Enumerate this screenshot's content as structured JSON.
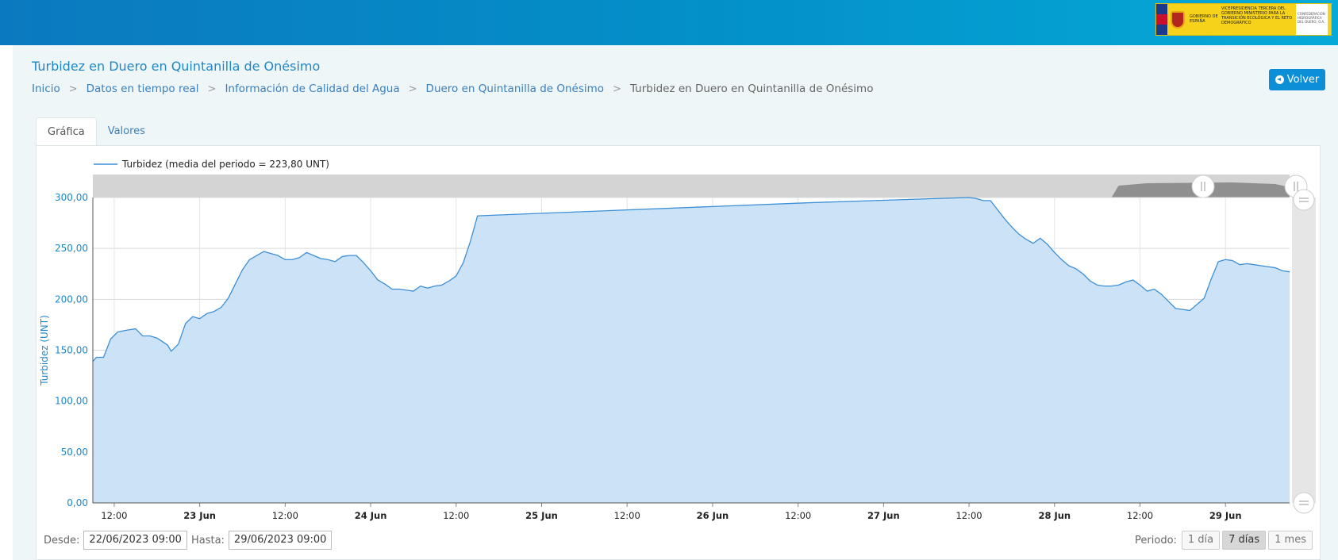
{
  "header": {
    "logo": {
      "gov_line": "GOBIERNO DE ESPAÑA",
      "ministry_line": "VICEPRESIDENCIA TERCERA DEL GOBIERNO MINISTERIO PARA LA TRANSICIÓN ECOLÓGICA Y EL RETO DEMOGRÁFICO",
      "agency_line": "CONFEDERACIÓN HIDROGRÁFICA DEL DUERO, O.A."
    }
  },
  "page": {
    "title": "Turbidez en Duero en Quintanilla de Onésimo",
    "back_label": "Volver",
    "breadcrumb": [
      "Inicio",
      "Datos en tiempo real",
      "Información de Calidad del Agua",
      "Duero en Quintanilla de Onésimo",
      "Turbidez en Duero en Quintanilla de Onésimo"
    ]
  },
  "tabs": [
    "Gráfica",
    "Valores"
  ],
  "range": {
    "from_label": "Desde:",
    "from_value": "22/06/2023 09:00",
    "to_label": "Hasta:",
    "to_value": "29/06/2023 09:00",
    "period_label": "Periodo:",
    "periods": [
      "1 día",
      "7 días",
      "1 mes"
    ],
    "selected_period": "7 días"
  },
  "colors": {
    "line": "#3d8fd6",
    "fill": "#c9e0f5",
    "axis_text": "#1e88c7",
    "accent": "#0d8fd8"
  },
  "chart_data": {
    "type": "area",
    "legend": "Turbidez  (media del periodo = 223,80 UNT)",
    "legend_position": "top-left",
    "ylabel": "Turbidez (UNT)",
    "ylim": [
      0,
      300
    ],
    "y_ticks": [
      "0,00",
      "50,00",
      "100,00",
      "150,00",
      "200,00",
      "250,00",
      "300,00"
    ],
    "x_ticks": [
      {
        "label": "12:00",
        "hours": 3,
        "bold": false
      },
      {
        "label": "23 Jun",
        "hours": 15,
        "bold": true
      },
      {
        "label": "12:00",
        "hours": 27,
        "bold": false
      },
      {
        "label": "24 Jun",
        "hours": 39,
        "bold": true
      },
      {
        "label": "12:00",
        "hours": 51,
        "bold": false
      },
      {
        "label": "25 Jun",
        "hours": 63,
        "bold": true
      },
      {
        "label": "12:00",
        "hours": 75,
        "bold": false
      },
      {
        "label": "26 Jun",
        "hours": 87,
        "bold": true
      },
      {
        "label": "12:00",
        "hours": 99,
        "bold": false
      },
      {
        "label": "27 Jun",
        "hours": 111,
        "bold": true
      },
      {
        "label": "12:00",
        "hours": 123,
        "bold": false
      },
      {
        "label": "28 Jun",
        "hours": 135,
        "bold": true
      },
      {
        "label": "12:00",
        "hours": 147,
        "bold": false
      },
      {
        "label": "29 Jun",
        "hours": 159,
        "bold": true
      }
    ],
    "x_hours": [
      0,
      0.5,
      1.5,
      2.5,
      3.5,
      5,
      6,
      7,
      8,
      9,
      10.5,
      11,
      12,
      13,
      14,
      15,
      16,
      17,
      18,
      19,
      20,
      21,
      22,
      23,
      24,
      25,
      26,
      27,
      28,
      29,
      30,
      31,
      32,
      33,
      34,
      35,
      36,
      37,
      38,
      39,
      40,
      41,
      42,
      43,
      44,
      45,
      46,
      47,
      48,
      49,
      50,
      51,
      52,
      53,
      54,
      101,
      123,
      124,
      125,
      126,
      127,
      128,
      129,
      130,
      131,
      132,
      133,
      134,
      135,
      136,
      137,
      138,
      139,
      140,
      141,
      142,
      143,
      144,
      145,
      146,
      147,
      148,
      149,
      150,
      151,
      152,
      153,
      154,
      155,
      156,
      157,
      158,
      159,
      160,
      161,
      162,
      163,
      164,
      165,
      166,
      167,
      168
    ],
    "values": [
      139,
      143,
      143,
      161,
      168,
      170,
      171,
      164,
      164,
      162,
      155,
      149,
      156,
      176,
      183,
      181,
      186,
      188,
      192,
      201,
      215,
      229,
      239,
      243,
      247,
      245,
      243,
      239,
      239,
      241,
      246,
      243,
      240,
      239,
      237,
      242,
      243,
      243,
      236,
      228,
      219,
      215,
      210,
      210,
      209,
      208,
      213,
      211,
      213,
      214,
      218,
      223,
      236,
      257,
      282,
      295,
      300,
      299,
      297,
      297,
      288,
      279,
      271,
      264,
      259,
      255,
      260,
      254,
      246,
      239,
      233,
      230,
      225,
      218,
      214,
      213,
      213,
      214,
      217,
      219,
      214,
      208,
      210,
      205,
      198,
      191,
      190,
      189,
      195,
      201,
      220,
      237,
      239,
      238,
      234,
      235,
      234,
      233,
      232,
      231,
      228,
      227,
      224,
      217
    ]
  }
}
